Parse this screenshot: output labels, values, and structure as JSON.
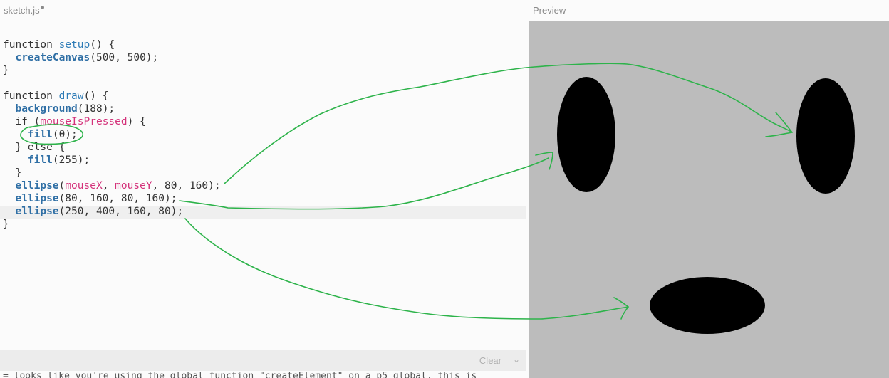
{
  "editor": {
    "file_name": "sketch.js",
    "code_lines": [
      [
        {
          "t": "function ",
          "c": "kw"
        },
        {
          "t": "setup",
          "c": "fn"
        },
        {
          "t": "() {",
          "c": "kw"
        }
      ],
      [
        {
          "t": "  ",
          "c": "kw"
        },
        {
          "t": "createCanvas",
          "c": "bi"
        },
        {
          "t": "(500, 500);",
          "c": "kw"
        }
      ],
      [
        {
          "t": "}",
          "c": "kw"
        }
      ],
      [
        {
          "t": "",
          "c": "kw"
        }
      ],
      [
        {
          "t": "function ",
          "c": "kw"
        },
        {
          "t": "draw",
          "c": "fn"
        },
        {
          "t": "() {",
          "c": "kw"
        }
      ],
      [
        {
          "t": "  ",
          "c": "kw"
        },
        {
          "t": "background",
          "c": "bi"
        },
        {
          "t": "(188);",
          "c": "kw"
        }
      ],
      [
        {
          "t": "  if (",
          "c": "kw"
        },
        {
          "t": "mouseIsPressed",
          "c": "var"
        },
        {
          "t": ") {",
          "c": "kw"
        }
      ],
      [
        {
          "t": "    ",
          "c": "kw"
        },
        {
          "t": "fill",
          "c": "bi"
        },
        {
          "t": "(0);",
          "c": "kw"
        }
      ],
      [
        {
          "t": "  } else {",
          "c": "kw"
        }
      ],
      [
        {
          "t": "    ",
          "c": "kw"
        },
        {
          "t": "fill",
          "c": "bi"
        },
        {
          "t": "(255);",
          "c": "kw"
        }
      ],
      [
        {
          "t": "  }",
          "c": "kw"
        }
      ],
      [
        {
          "t": "  ",
          "c": "kw"
        },
        {
          "t": "ellipse",
          "c": "bi"
        },
        {
          "t": "(",
          "c": "kw"
        },
        {
          "t": "mouseX",
          "c": "var"
        },
        {
          "t": ", ",
          "c": "kw"
        },
        {
          "t": "mouseY",
          "c": "var"
        },
        {
          "t": ", 80, 160);",
          "c": "kw"
        }
      ],
      [
        {
          "t": "  ",
          "c": "kw"
        },
        {
          "t": "ellipse",
          "c": "bi"
        },
        {
          "t": "(80, 160, 80, 160);",
          "c": "kw"
        }
      ],
      [
        {
          "t": "  ",
          "c": "kw"
        },
        {
          "t": "ellipse",
          "c": "bi"
        },
        {
          "t": "(250, 400, 160, 80);",
          "c": "kw"
        }
      ],
      [
        {
          "t": "}",
          "c": "kw"
        }
      ]
    ]
  },
  "console": {
    "clear_label": "Clear",
    "message": "= looks like you're using the global function \"createElement\" on a p5 global, this is"
  },
  "preview": {
    "title": "Preview",
    "background": "#bcbcbc",
    "shape_fill": "#000000"
  },
  "annotation_color": "#2db34a"
}
